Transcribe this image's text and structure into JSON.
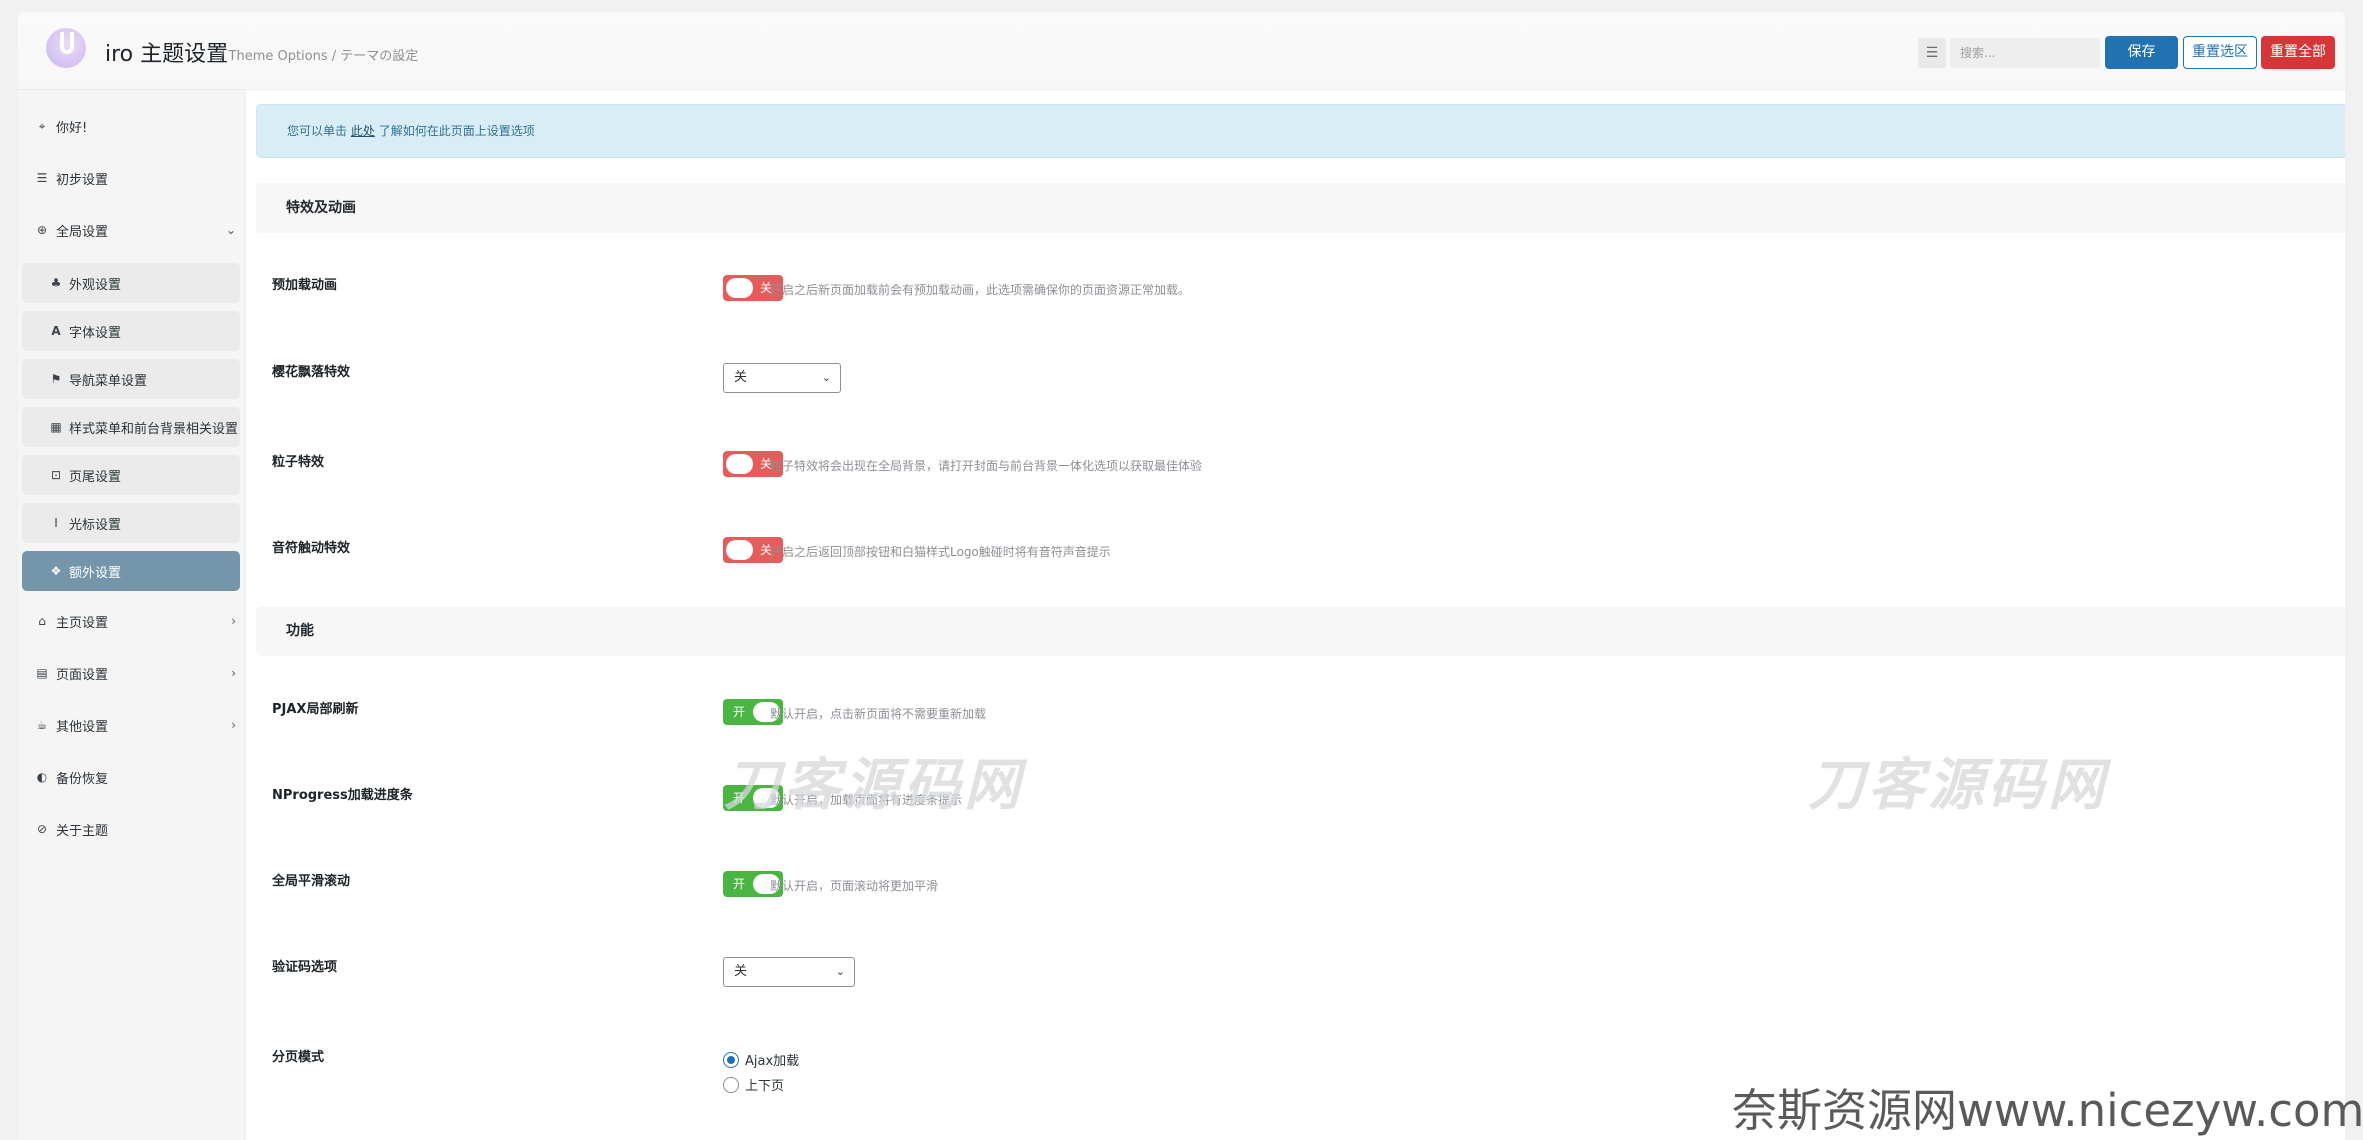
{
  "header": {
    "title": "iro 主题设置",
    "subtitle": "/ Theme Options / テーマの設定",
    "expand_icon": "expand-icon",
    "search_placeholder": "搜索...",
    "save_label": "保存",
    "reset_section_label": "重置选区",
    "reset_all_label": "重置全部"
  },
  "sidebar": {
    "items": [
      {
        "label": "你好!",
        "icon": "location-icon"
      },
      {
        "label": "初步设置",
        "icon": "sliders-icon"
      },
      {
        "label": "全局设置",
        "icon": "globe-icon"
      },
      {
        "label": "主页设置",
        "icon": "home-icon"
      },
      {
        "label": "页面设置",
        "icon": "file-icon"
      },
      {
        "label": "其他设置",
        "icon": "coffee-icon"
      },
      {
        "label": "备份恢复",
        "icon": "shield-icon"
      },
      {
        "label": "关于主题",
        "icon": "paperclip-icon"
      }
    ],
    "subitems": [
      {
        "label": "外观设置",
        "icon": "tree-icon"
      },
      {
        "label": "字体设置",
        "icon": "font-icon"
      },
      {
        "label": "导航菜单设置",
        "icon": "signs-icon"
      },
      {
        "label": "样式菜单和前台背景相关设置",
        "icon": "grid-icon"
      },
      {
        "label": "页尾设置",
        "icon": "square-icon"
      },
      {
        "label": "光标设置",
        "icon": "cursor-icon"
      },
      {
        "label": "额外设置",
        "icon": "gift-icon"
      }
    ]
  },
  "notice": {
    "prefix": "您可以单击",
    "link": "此处",
    "suffix": "了解如何在此页面上设置选项"
  },
  "sections": {
    "effects": "特效及动画",
    "features": "功能"
  },
  "fields": {
    "preload": {
      "label": "预加载动画",
      "state": "关",
      "desc": "开启之后新页面加载前会有预加载动画，此选项需确保你的页面资源正常加载。"
    },
    "sakura": {
      "label": "樱花飘落特效",
      "value": "关"
    },
    "particles": {
      "label": "粒子特效",
      "state": "关",
      "desc": "粒子特效将会出现在全局背景，请打开封面与前台背景一体化选项以获取最佳体验"
    },
    "notes": {
      "label": "音符触动特效",
      "state": "关",
      "desc": "开启之后返回顶部按钮和白猫样式Logo触碰时将有音符声音提示"
    },
    "pjax": {
      "label": "PJAX局部刷新",
      "state": "开",
      "desc": "默认开启，点击新页面将不需要重新加载"
    },
    "nprogress": {
      "label": "NProgress加载进度条",
      "state": "开",
      "desc": "默认开启，加载页面将有进度条提示"
    },
    "smooth": {
      "label": "全局平滑滚动",
      "state": "开",
      "desc": "默认开启，页面滚动将更加平滑"
    },
    "captcha": {
      "label": "验证码选项",
      "value": "关"
    },
    "pagination": {
      "label": "分页模式",
      "options": [
        "Ajax加载",
        "上下页"
      ],
      "selected": "Ajax加载"
    }
  },
  "watermarks": {
    "center": "刀客源码网",
    "right": "刀客源码网",
    "footer": "奈斯资源网www.nicezyw.com"
  },
  "colors": {
    "primary": "#2271b1",
    "danger": "#d63638",
    "switch_off": "#e55c5c",
    "switch_on": "#4bb543",
    "active_nav": "#7596aa",
    "notice_bg": "#d9edf7"
  }
}
